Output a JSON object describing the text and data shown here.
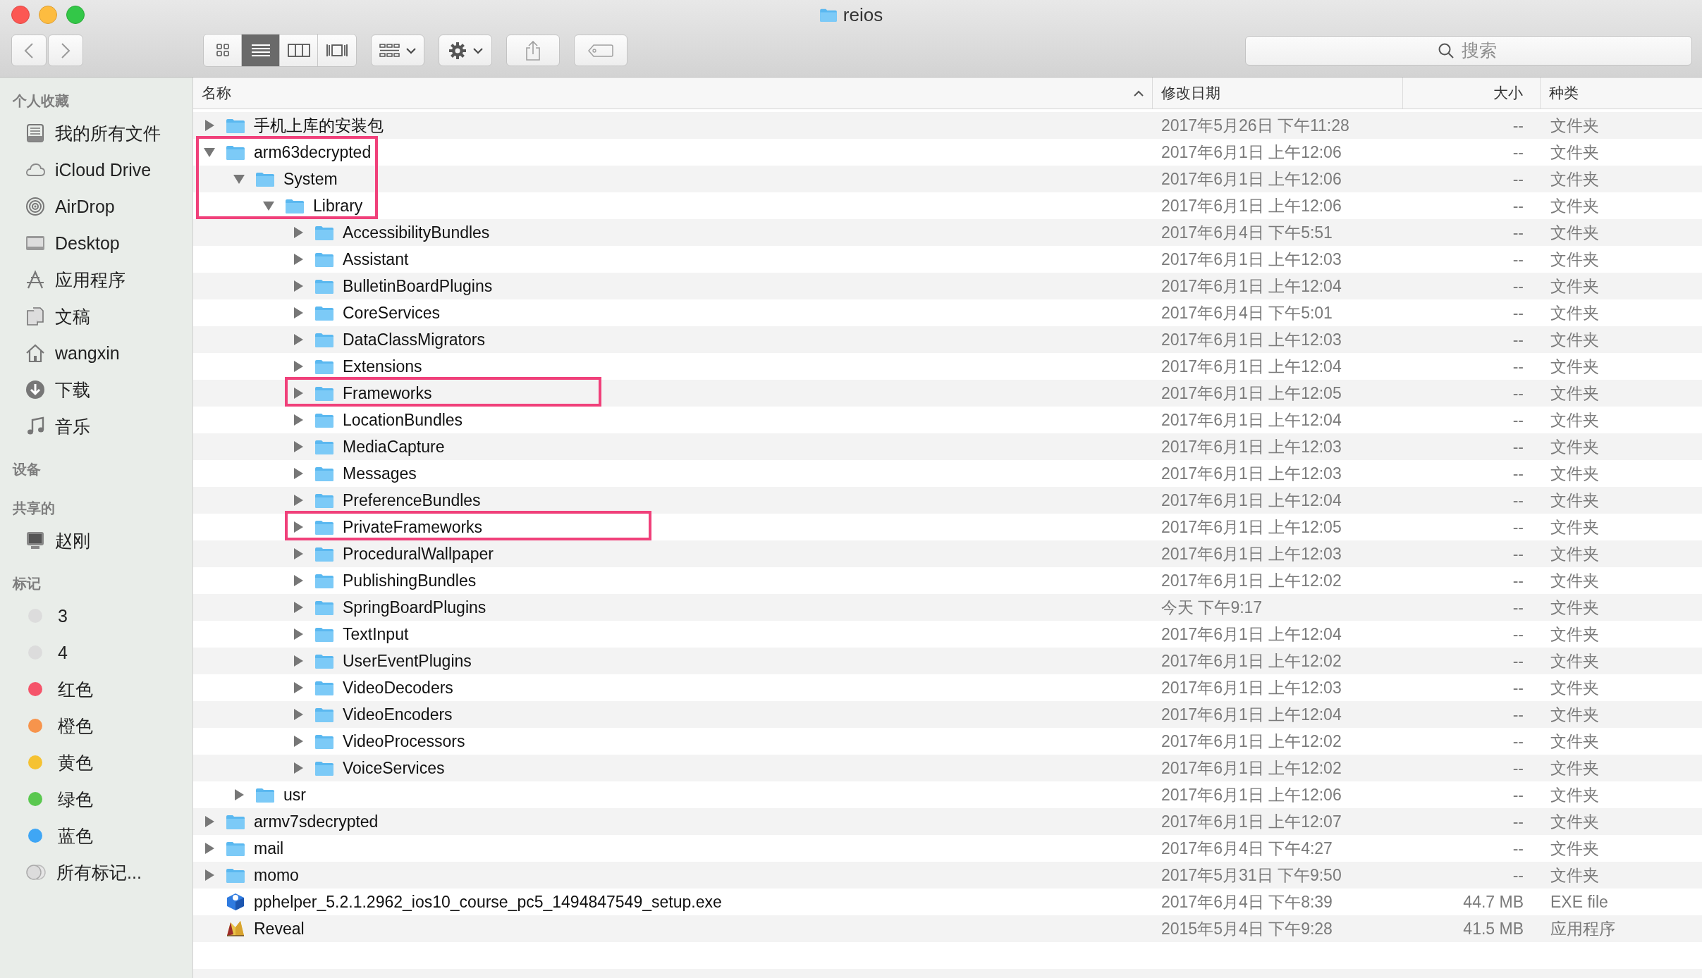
{
  "window": {
    "title": "reios"
  },
  "toolbar": {
    "view_modes": [
      {
        "kind": "icons",
        "selected": false
      },
      {
        "kind": "list",
        "selected": true
      },
      {
        "kind": "columns",
        "selected": false
      },
      {
        "kind": "gallery",
        "selected": false
      }
    ]
  },
  "search": {
    "placeholder": "搜索"
  },
  "sidebar": {
    "sections": [
      {
        "title": "个人收藏",
        "items": [
          {
            "label": "我的所有文件",
            "kind": "drawer"
          },
          {
            "label": "iCloud Drive",
            "kind": "cloud"
          },
          {
            "label": "AirDrop",
            "kind": "airdrop"
          },
          {
            "label": "Desktop",
            "kind": "desktop"
          },
          {
            "label": "应用程序",
            "kind": "apps"
          },
          {
            "label": "文稿",
            "kind": "docs"
          },
          {
            "label": "wangxin",
            "kind": "home"
          },
          {
            "label": "下载",
            "kind": "download"
          },
          {
            "label": "音乐",
            "kind": "music"
          }
        ]
      },
      {
        "title": "设备"
      },
      {
        "title": "共享的",
        "items": [
          {
            "label": "赵刚",
            "kind": "computer"
          }
        ]
      },
      {
        "title": "标记",
        "items": [
          {
            "label": "3",
            "kind": "tag",
            "color": "#dcdcdc"
          },
          {
            "label": "4",
            "kind": "tag",
            "color": "#dcdcdc"
          },
          {
            "label": "红色",
            "kind": "tag",
            "color": "#f5546a"
          },
          {
            "label": "橙色",
            "kind": "tag",
            "color": "#f7944c"
          },
          {
            "label": "黄色",
            "kind": "tag",
            "color": "#f5c232"
          },
          {
            "label": "绿色",
            "kind": "tag",
            "color": "#5ac84f"
          },
          {
            "label": "蓝色",
            "kind": "tag",
            "color": "#3fa6f5"
          },
          {
            "label": "所有标记...",
            "kind": "alltags"
          }
        ]
      }
    ]
  },
  "columns": [
    {
      "label": "名称",
      "sorted": true
    },
    {
      "label": "修改日期",
      "sorted": false
    },
    {
      "label": "大小",
      "sorted": false
    },
    {
      "label": "种类",
      "sorted": false
    }
  ],
  "rows": [
    {
      "name": "手机上库的安装包",
      "date": "2017年5月26日 下午11:28",
      "size": "--",
      "type": "文件夹",
      "kind": "folder",
      "expanded": false,
      "highlight": false
    },
    {
      "name": "arm63decrypted",
      "date": "2017年6月1日 上午12:06",
      "size": "--",
      "type": "文件夹",
      "kind": "folder",
      "expanded": true,
      "highlight": true,
      "children": [
        {
          "name": "System",
          "date": "2017年6月1日 上午12:06",
          "size": "--",
          "type": "文件夹",
          "kind": "folder",
          "expanded": true,
          "highlight": true,
          "children": [
            {
              "name": "Library",
              "date": "2017年6月1日 上午12:06",
              "size": "--",
              "type": "文件夹",
              "kind": "folder",
              "expanded": true,
              "highlight": true,
              "children": [
                {
                  "name": "AccessibilityBundles",
                  "date": "2017年6月4日 下午5:51",
                  "size": "--",
                  "type": "文件夹",
                  "kind": "folder",
                  "expanded": false,
                  "highlight": false
                },
                {
                  "name": "Assistant",
                  "date": "2017年6月1日 上午12:03",
                  "size": "--",
                  "type": "文件夹",
                  "kind": "folder",
                  "expanded": false,
                  "highlight": false
                },
                {
                  "name": "BulletinBoardPlugins",
                  "date": "2017年6月1日 上午12:04",
                  "size": "--",
                  "type": "文件夹",
                  "kind": "folder",
                  "expanded": false,
                  "highlight": false
                },
                {
                  "name": "CoreServices",
                  "date": "2017年6月4日 下午5:01",
                  "size": "--",
                  "type": "文件夹",
                  "kind": "folder",
                  "expanded": false,
                  "highlight": false
                },
                {
                  "name": "DataClassMigrators",
                  "date": "2017年6月1日 上午12:03",
                  "size": "--",
                  "type": "文件夹",
                  "kind": "folder",
                  "expanded": false,
                  "highlight": false
                },
                {
                  "name": "Extensions",
                  "date": "2017年6月1日 上午12:04",
                  "size": "--",
                  "type": "文件夹",
                  "kind": "folder",
                  "expanded": false,
                  "highlight": false
                },
                {
                  "name": "Frameworks",
                  "date": "2017年6月1日 上午12:05",
                  "size": "--",
                  "type": "文件夹",
                  "kind": "folder",
                  "expanded": false,
                  "highlight": true
                },
                {
                  "name": "LocationBundles",
                  "date": "2017年6月1日 上午12:04",
                  "size": "--",
                  "type": "文件夹",
                  "kind": "folder",
                  "expanded": false,
                  "highlight": false
                },
                {
                  "name": "MediaCapture",
                  "date": "2017年6月1日 上午12:03",
                  "size": "--",
                  "type": "文件夹",
                  "kind": "folder",
                  "expanded": false,
                  "highlight": false
                },
                {
                  "name": "Messages",
                  "date": "2017年6月1日 上午12:03",
                  "size": "--",
                  "type": "文件夹",
                  "kind": "folder",
                  "expanded": false,
                  "highlight": false
                },
                {
                  "name": "PreferenceBundles",
                  "date": "2017年6月1日 上午12:04",
                  "size": "--",
                  "type": "文件夹",
                  "kind": "folder",
                  "expanded": false,
                  "highlight": false
                },
                {
                  "name": "PrivateFrameworks",
                  "date": "2017年6月1日 上午12:05",
                  "size": "--",
                  "type": "文件夹",
                  "kind": "folder",
                  "expanded": false,
                  "highlight": true
                },
                {
                  "name": "ProceduralWallpaper",
                  "date": "2017年6月1日 上午12:03",
                  "size": "--",
                  "type": "文件夹",
                  "kind": "folder",
                  "expanded": false,
                  "highlight": false
                },
                {
                  "name": "PublishingBundles",
                  "date": "2017年6月1日 上午12:02",
                  "size": "--",
                  "type": "文件夹",
                  "kind": "folder",
                  "expanded": false,
                  "highlight": false
                },
                {
                  "name": "SpringBoardPlugins",
                  "date": "今天 下午9:17",
                  "size": "--",
                  "type": "文件夹",
                  "kind": "folder",
                  "expanded": false,
                  "highlight": false
                },
                {
                  "name": "TextInput",
                  "date": "2017年6月1日 上午12:04",
                  "size": "--",
                  "type": "文件夹",
                  "kind": "folder",
                  "expanded": false,
                  "highlight": false
                },
                {
                  "name": "UserEventPlugins",
                  "date": "2017年6月1日 上午12:02",
                  "size": "--",
                  "type": "文件夹",
                  "kind": "folder",
                  "expanded": false,
                  "highlight": false
                },
                {
                  "name": "VideoDecoders",
                  "date": "2017年6月1日 上午12:03",
                  "size": "--",
                  "type": "文件夹",
                  "kind": "folder",
                  "expanded": false,
                  "highlight": false
                },
                {
                  "name": "VideoEncoders",
                  "date": "2017年6月1日 上午12:04",
                  "size": "--",
                  "type": "文件夹",
                  "kind": "folder",
                  "expanded": false,
                  "highlight": false
                },
                {
                  "name": "VideoProcessors",
                  "date": "2017年6月1日 上午12:02",
                  "size": "--",
                  "type": "文件夹",
                  "kind": "folder",
                  "expanded": false,
                  "highlight": false
                },
                {
                  "name": "VoiceServices",
                  "date": "2017年6月1日 上午12:02",
                  "size": "--",
                  "type": "文件夹",
                  "kind": "folder",
                  "expanded": false,
                  "highlight": false
                }
              ]
            }
          ]
        },
        {
          "name": "usr",
          "date": "2017年6月1日 上午12:06",
          "size": "--",
          "type": "文件夹",
          "kind": "folder",
          "expanded": false,
          "highlight": false
        }
      ]
    },
    {
      "name": "armv7sdecrypted",
      "date": "2017年6月1日 上午12:07",
      "size": "--",
      "type": "文件夹",
      "kind": "folder",
      "expanded": false,
      "highlight": false
    },
    {
      "name": "mail",
      "date": "2017年6月4日 下午4:27",
      "size": "--",
      "type": "文件夹",
      "kind": "folder",
      "expanded": false,
      "highlight": false
    },
    {
      "name": "momo",
      "date": "2017年5月31日 下午9:50",
      "size": "--",
      "type": "文件夹",
      "kind": "folder",
      "expanded": false,
      "highlight": false
    },
    {
      "name": "pphelper_5.2.1.2962_ios10_course_pc5_1494847549_setup.exe",
      "date": "2017年6月4日 下午8:39",
      "size": "44.7 MB",
      "type": "EXE file",
      "kind": "exe",
      "highlight": false
    },
    {
      "name": "Reveal",
      "date": "2015年5月4日 下午9:28",
      "size": "41.5 MB",
      "type": "应用程序",
      "kind": "app",
      "highlight": false
    }
  ]
}
